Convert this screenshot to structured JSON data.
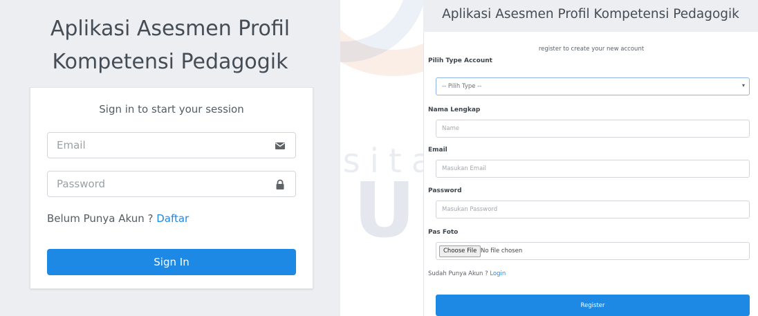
{
  "login": {
    "app_title_line1": "Aplikasi Asesmen Profil",
    "app_title_line2": "Kompetensi Pedagogik",
    "message": "Sign in to start your session",
    "email_placeholder": "Email",
    "email_icon": "envelope-icon",
    "password_placeholder": "Password",
    "password_icon": "lock-icon",
    "no_account_text": "Belum Punya Akun ?",
    "register_link": "Daftar",
    "signin_button": "Sign In"
  },
  "register": {
    "app_title": "Aplikasi Asesmen Profil Kompetensi Pedagogik",
    "message": "register to create your new account",
    "account_type_label": "Pilih Type Account",
    "account_type_selected": "-- Pilih Type --",
    "fullname_label": "Nama Lengkap",
    "fullname_placeholder": "Name",
    "email_label": "Email",
    "email_placeholder": "Masukan Email",
    "password_label": "Password",
    "password_placeholder": "Masukan Password",
    "photo_label": "Pas Foto",
    "choose_file_button": "Choose File",
    "no_file_text": "No file chosen",
    "have_account_text": "Sudah Punya Akun ?",
    "login_link": "Login",
    "register_button": "Register"
  },
  "watermark": {
    "line1": "Universitas",
    "line2": "Esa Unggul"
  },
  "colors": {
    "accent": "#1e88e5",
    "panel_bg": "#eceef1",
    "card_bg": "#ffffff"
  }
}
